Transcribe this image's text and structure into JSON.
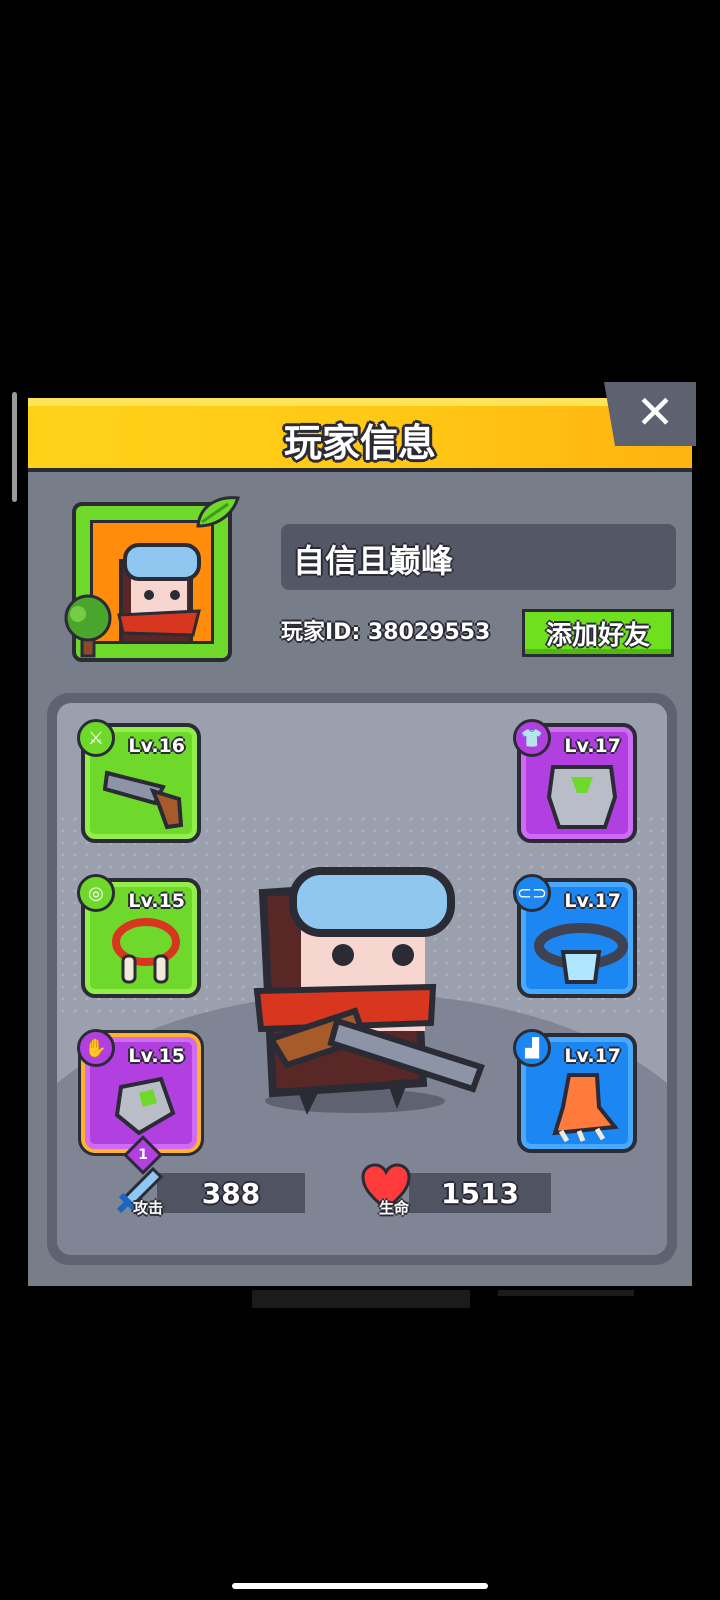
{
  "panel": {
    "title": "玩家信息",
    "close_icon": "✕"
  },
  "player": {
    "name": "自信且巅峰",
    "id_label": "玩家ID: 38029553",
    "add_friend_label": "添加好友"
  },
  "equipment": [
    {
      "slot": "weapon",
      "level": "Lv.16",
      "rarity_color": "#6fd92b",
      "icon": "pistol-icon"
    },
    {
      "slot": "necklace",
      "level": "Lv.15",
      "rarity_color": "#6fd92b",
      "icon": "bone-necklace-icon"
    },
    {
      "slot": "gloves",
      "level": "Lv.15",
      "rarity_color": "#b23fe0",
      "icon": "gauntlet-icon",
      "star_level": "1"
    },
    {
      "slot": "armor",
      "level": "Lv.17",
      "rarity_color": "#b23fe0",
      "icon": "armor-icon"
    },
    {
      "slot": "belt",
      "level": "Lv.17",
      "rarity_color": "#1c86f2",
      "icon": "belt-icon"
    },
    {
      "slot": "boots",
      "level": "Lv.17",
      "rarity_color": "#1c86f2",
      "icon": "claw-boots-icon"
    }
  ],
  "stats": {
    "attack_label": "攻击",
    "attack_value": "388",
    "hp_label": "生命",
    "hp_value": "1513"
  }
}
